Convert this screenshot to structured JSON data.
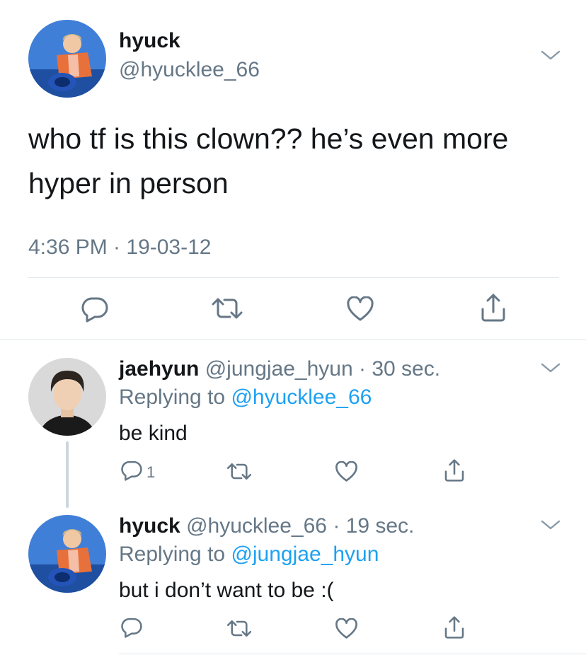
{
  "main_tweet": {
    "display_name": "hyuck",
    "handle": "@hyucklee_66",
    "text_line1": "who tf is this clown?? he’s even more",
    "text_line2": "hyper in person",
    "timestamp": "4:36 PM · 19-03-12"
  },
  "replies": [
    {
      "display_name": "jaehyun",
      "handle": "@jungjae_hyun",
      "time": "· 30 sec.",
      "replying_prefix": "Replying to",
      "replying_to": "@hyucklee_66",
      "text": "be kind",
      "reply_count": "1"
    },
    {
      "display_name": "hyuck",
      "handle": "@hyucklee_66",
      "time": "· 19 sec.",
      "replying_prefix": "Replying to",
      "replying_to": "@jungjae_hyun",
      "text": "but i don’t want to be :(",
      "reply_count": ""
    }
  ],
  "colors": {
    "accent": "#1da1f2",
    "secondary_text": "#657786",
    "icon": "#657786"
  },
  "icons": [
    "reply-icon",
    "retweet-icon",
    "like-icon",
    "share-icon",
    "chevron-down-icon"
  ]
}
